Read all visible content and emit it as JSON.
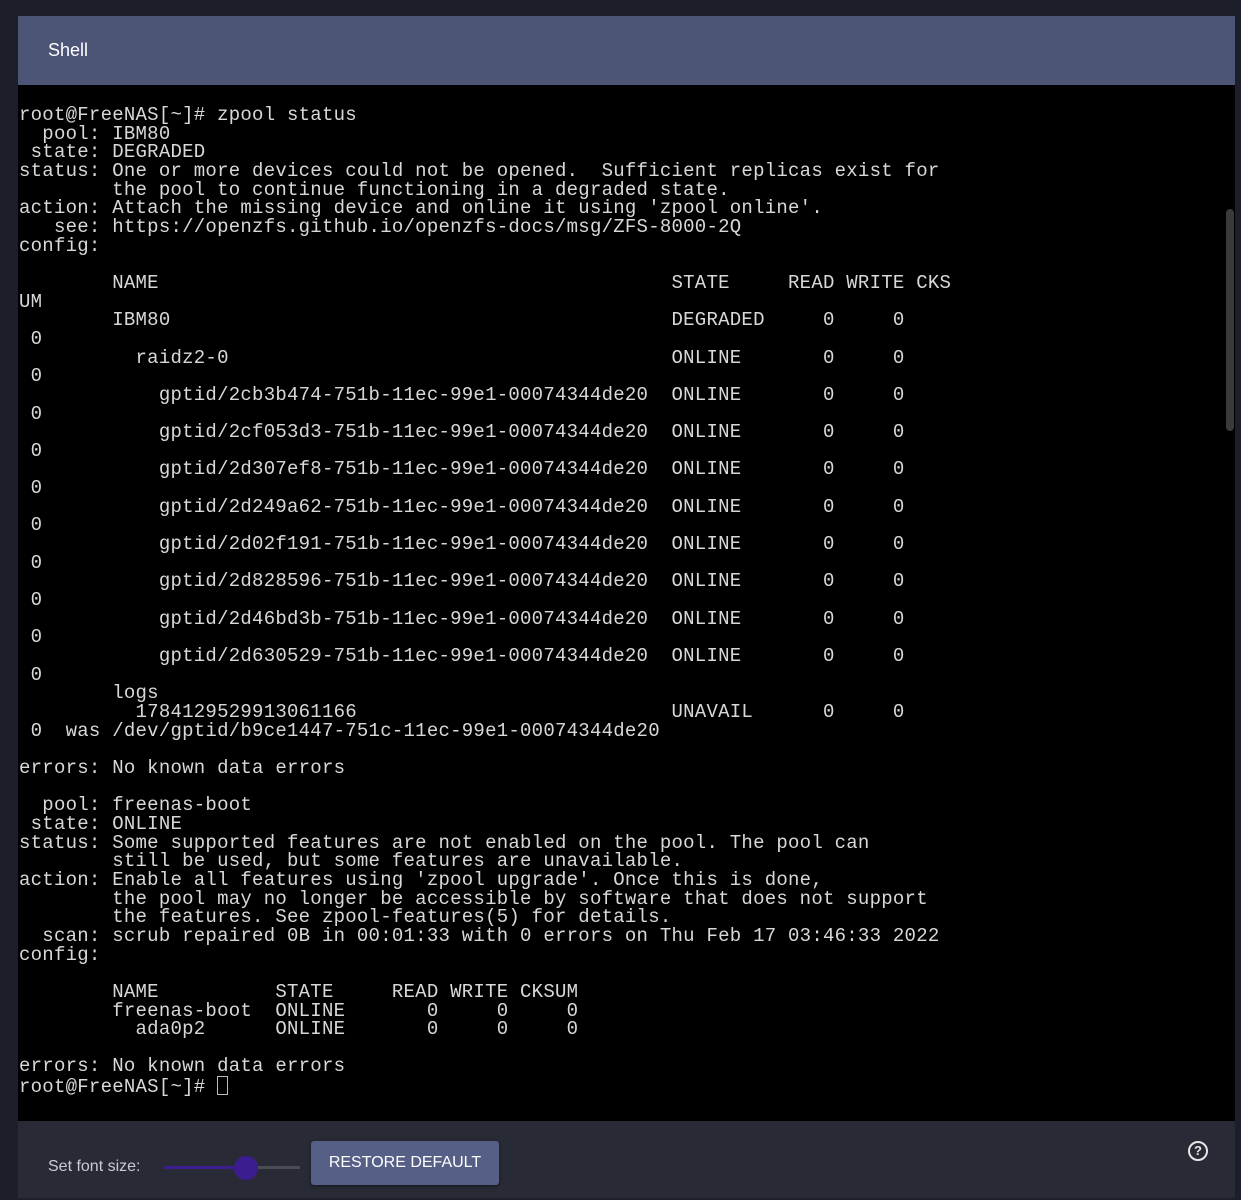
{
  "window": {
    "title": "Shell"
  },
  "terminal": {
    "lines": [
      "root@FreeNAS[~]# zpool status",
      "  pool: IBM80",
      " state: DEGRADED",
      "status: One or more devices could not be opened.  Sufficient replicas exist for",
      "        the pool to continue functioning in a degraded state.",
      "action: Attach the missing device and online it using 'zpool online'.",
      "   see: https://openzfs.github.io/openzfs-docs/msg/ZFS-8000-2Q",
      "config:",
      "",
      "        NAME                                            STATE     READ WRITE CKS",
      "UM",
      "        IBM80                                           DEGRADED     0     0",
      " 0",
      "          raidz2-0                                      ONLINE       0     0",
      " 0",
      "            gptid/2cb3b474-751b-11ec-99e1-00074344de20  ONLINE       0     0",
      " 0",
      "            gptid/2cf053d3-751b-11ec-99e1-00074344de20  ONLINE       0     0",
      " 0",
      "            gptid/2d307ef8-751b-11ec-99e1-00074344de20  ONLINE       0     0",
      " 0",
      "            gptid/2d249a62-751b-11ec-99e1-00074344de20  ONLINE       0     0",
      " 0",
      "            gptid/2d02f191-751b-11ec-99e1-00074344de20  ONLINE       0     0",
      " 0",
      "            gptid/2d828596-751b-11ec-99e1-00074344de20  ONLINE       0     0",
      " 0",
      "            gptid/2d46bd3b-751b-11ec-99e1-00074344de20  ONLINE       0     0",
      " 0",
      "            gptid/2d630529-751b-11ec-99e1-00074344de20  ONLINE       0     0",
      " 0",
      "        logs",
      "          1784129529913061166                           UNAVAIL      0     0",
      " 0  was /dev/gptid/b9ce1447-751c-11ec-99e1-00074344de20",
      "",
      "errors: No known data errors",
      "",
      "  pool: freenas-boot",
      " state: ONLINE",
      "status: Some supported features are not enabled on the pool. The pool can",
      "        still be used, but some features are unavailable.",
      "action: Enable all features using 'zpool upgrade'. Once this is done,",
      "        the pool may no longer be accessible by software that does not support",
      "        the features. See zpool-features(5) for details.",
      "  scan: scrub repaired 0B in 00:01:33 with 0 errors on Thu Feb 17 03:46:33 2022",
      "config:",
      "",
      "        NAME          STATE     READ WRITE CKSUM",
      "        freenas-boot  ONLINE       0     0     0",
      "          ada0p2      ONLINE       0     0     0",
      "",
      "errors: No known data errors"
    ],
    "prompt": "root@FreeNAS[~]# "
  },
  "footer": {
    "font_size_label": "Set font size:",
    "restore_label": "RESTORE DEFAULT",
    "help_symbol": "?",
    "font_size_slider_fraction": 0.6
  },
  "colors": {
    "titlebar": "#4d5577",
    "terminal_bg": "#000000",
    "terminal_fg": "#d8d8d8",
    "footer_bg": "#282a36",
    "button_bg": "#565f86",
    "slider_accent": "#3b1d8f"
  },
  "icons": {
    "help": "help-circle-icon"
  }
}
